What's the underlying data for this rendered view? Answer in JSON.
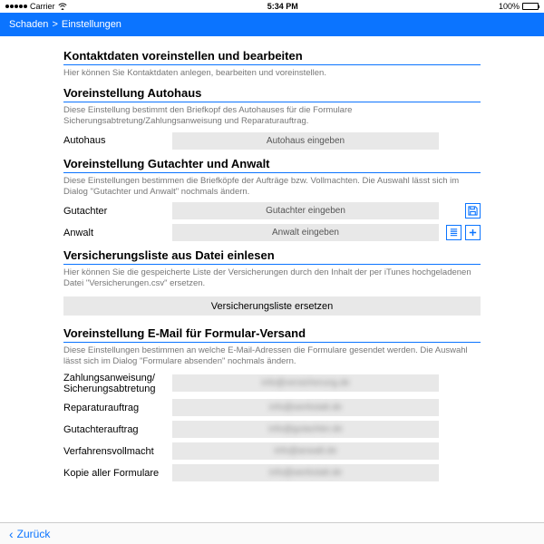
{
  "status": {
    "carrier": "Carrier",
    "time": "5:34 PM",
    "battery": "100%"
  },
  "nav": {
    "crumb1": "Schaden",
    "sep": ">",
    "crumb2": "Einstellungen"
  },
  "s1": {
    "title": "Kontaktdaten voreinstellen und bearbeiten",
    "desc": "Hier können Sie Kontaktdaten anlegen, bearbeiten und voreinstellen."
  },
  "s2": {
    "title": "Voreinstellung Autohaus",
    "desc": "Diese Einstellung bestimmt den Briefkopf des Autohauses für die Formulare Sicherungsabtretung/Zahlungsanweisung und Reparaturauftrag.",
    "label": "Autohaus",
    "placeholder": "Autohaus eingeben"
  },
  "s3": {
    "title": "Voreinstellung Gutachter und Anwalt",
    "desc": "Diese Einstellungen bestimmen die Briefköpfe der Aufträge bzw. Vollmachten. Die Auswahl lässt sich im Dialog \"Gutachter und Anwalt\" nochmals ändern.",
    "r1_label": "Gutachter",
    "r1_ph": "Gutachter eingeben",
    "r2_label": "Anwalt",
    "r2_ph": "Anwalt eingeben"
  },
  "s4": {
    "title": "Versicherungsliste aus Datei einlesen",
    "desc": "Hier können Sie die gespeicherte Liste der Versicherungen durch den Inhalt der per iTunes hochgeladenen Datei \"Versicherungen.csv\" ersetzen.",
    "button": "Versicherungsliste ersetzen"
  },
  "s5": {
    "title": "Voreinstellung E-Mail für Formular-Versand",
    "desc": "Diese Einstellungen bestimmen an welche E-Mail-Adressen die Formulare gesendet werden. Die Auswahl lässt sich im Dialog \"Formulare absenden\" nochmals ändern.",
    "rows": {
      "0": {
        "label": "Zahlungsanweisung/\nSicherungsabtretung",
        "val": "info@versicherung.de"
      },
      "1": {
        "label": "Reparaturauftrag",
        "val": "info@werkstatt.de"
      },
      "2": {
        "label": "Gutachterauftrag",
        "val": "info@gutachter.de"
      },
      "3": {
        "label": "Verfahrensvollmacht",
        "val": "info@anwalt.de"
      },
      "4": {
        "label": "Kopie aller Formulare",
        "val": "info@werkstatt.de"
      }
    }
  },
  "bottom": {
    "back": "Zurück"
  }
}
